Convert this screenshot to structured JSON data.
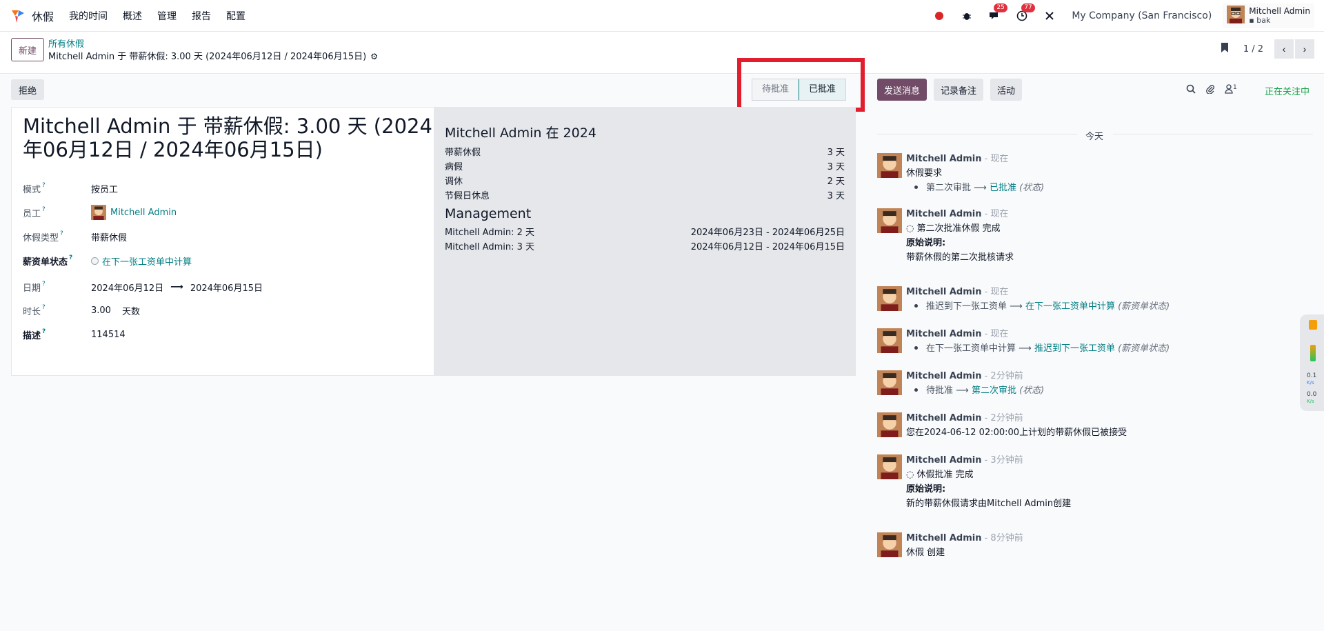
{
  "nav": {
    "app_name": "休假",
    "menu": [
      "我的时间",
      "概述",
      "管理",
      "报告",
      "配置"
    ],
    "messages_count": "25",
    "activities_count": "77",
    "company": "My Company (San Francisco)",
    "user_name": "Mitchell Admin",
    "user_db": "bak"
  },
  "control": {
    "new_label": "新建",
    "breadcrumb_parent": "所有休假",
    "breadcrumb_current": "Mitchell Admin 于 带薪休假: 3.00 天 (2024年06月12日 / 2024年06月15日)",
    "pager": "1 / 2"
  },
  "statusbar": {
    "refuse_label": "拒绝",
    "stages": [
      "待批准",
      "已批准"
    ],
    "active_stage": "已批准"
  },
  "form": {
    "title": "Mitchell Admin 于 带薪休假: 3.00 天 (2024年06月12日 / 2024年06月15日)",
    "fields": {
      "mode_label": "模式",
      "mode_value": "按员工",
      "employee_label": "员工",
      "employee_value": "Mitchell Admin",
      "type_label": "休假类型",
      "type_value": "带薪休假",
      "payslip_label": "薪资单状态",
      "payslip_value": "在下一张工资单中计算",
      "date_label": "日期",
      "date_from": "2024年06月12日",
      "date_to": "2024年06月15日",
      "duration_label": "时长",
      "duration_value": "3.00",
      "duration_unit": "天数",
      "desc_label": "描述",
      "desc_value": "114514"
    }
  },
  "summary": {
    "heading": "Mitchell Admin 在 2024",
    "rows": [
      {
        "name": "带薪休假",
        "value": "3 天"
      },
      {
        "name": "病假",
        "value": "3 天"
      },
      {
        "name": "调休",
        "value": "2 天"
      },
      {
        "name": "节假日休息",
        "value": "3 天"
      }
    ],
    "mgmt_heading": "Management",
    "mgmt_rows": [
      {
        "name": "Mitchell Admin: 2 天",
        "value": "2024年06月23日 - 2024年06月25日"
      },
      {
        "name": "Mitchell Admin: 3 天",
        "value": "2024年06月12日 - 2024年06月15日"
      }
    ]
  },
  "chatter": {
    "send_label": "发送消息",
    "note_label": "记录备注",
    "activity_label": "活动",
    "follower_count": "1",
    "following_label": "正在关注中",
    "day": "今天",
    "messages": [
      {
        "author": "Mitchell Admin",
        "time": "- 现在",
        "text": "休假要求",
        "track_old": "第二次审批",
        "track_new": "已批准",
        "track_field": "(状态)"
      },
      {
        "author": "Mitchell Admin",
        "time": "- 现在",
        "text": "第二次批准休假 完成",
        "note_label": "原始说明:",
        "note": "带薪休假的第二次批核请求"
      },
      {
        "author": "Mitchell Admin",
        "time": "- 现在",
        "track_old": "推迟到下一张工资单",
        "track_new": "在下一张工资单中计算",
        "track_field": "(薪资单状态)"
      },
      {
        "author": "Mitchell Admin",
        "time": "- 现在",
        "track_old": "在下一张工资单中计算",
        "track_new": "推迟到下一张工资单",
        "track_field": "(薪资单状态)"
      },
      {
        "author": "Mitchell Admin",
        "time": "- 2分钟前",
        "track_old": "待批准",
        "track_new": "第二次审批",
        "track_field": "(状态)"
      },
      {
        "author": "Mitchell Admin",
        "time": "- 2分钟前",
        "text": "您在2024-06-12 02:00:00上计划的带薪休假已被接受"
      },
      {
        "author": "Mitchell Admin",
        "time": "- 3分钟前",
        "text": "休假批准 完成",
        "note_label": "原始说明:",
        "note": "新的带薪休假请求由Mitchell Admin创建"
      },
      {
        "author": "Mitchell Admin",
        "time": "- 8分钟前",
        "text": "休假 创建"
      }
    ]
  },
  "widget": {
    "v1": "0.1",
    "v2": "0.0",
    "unit": "K/s"
  },
  "colors": {
    "brand": "#714b67",
    "link": "#017e84",
    "highlight": "#e11d2e",
    "following": "#16a34a"
  }
}
